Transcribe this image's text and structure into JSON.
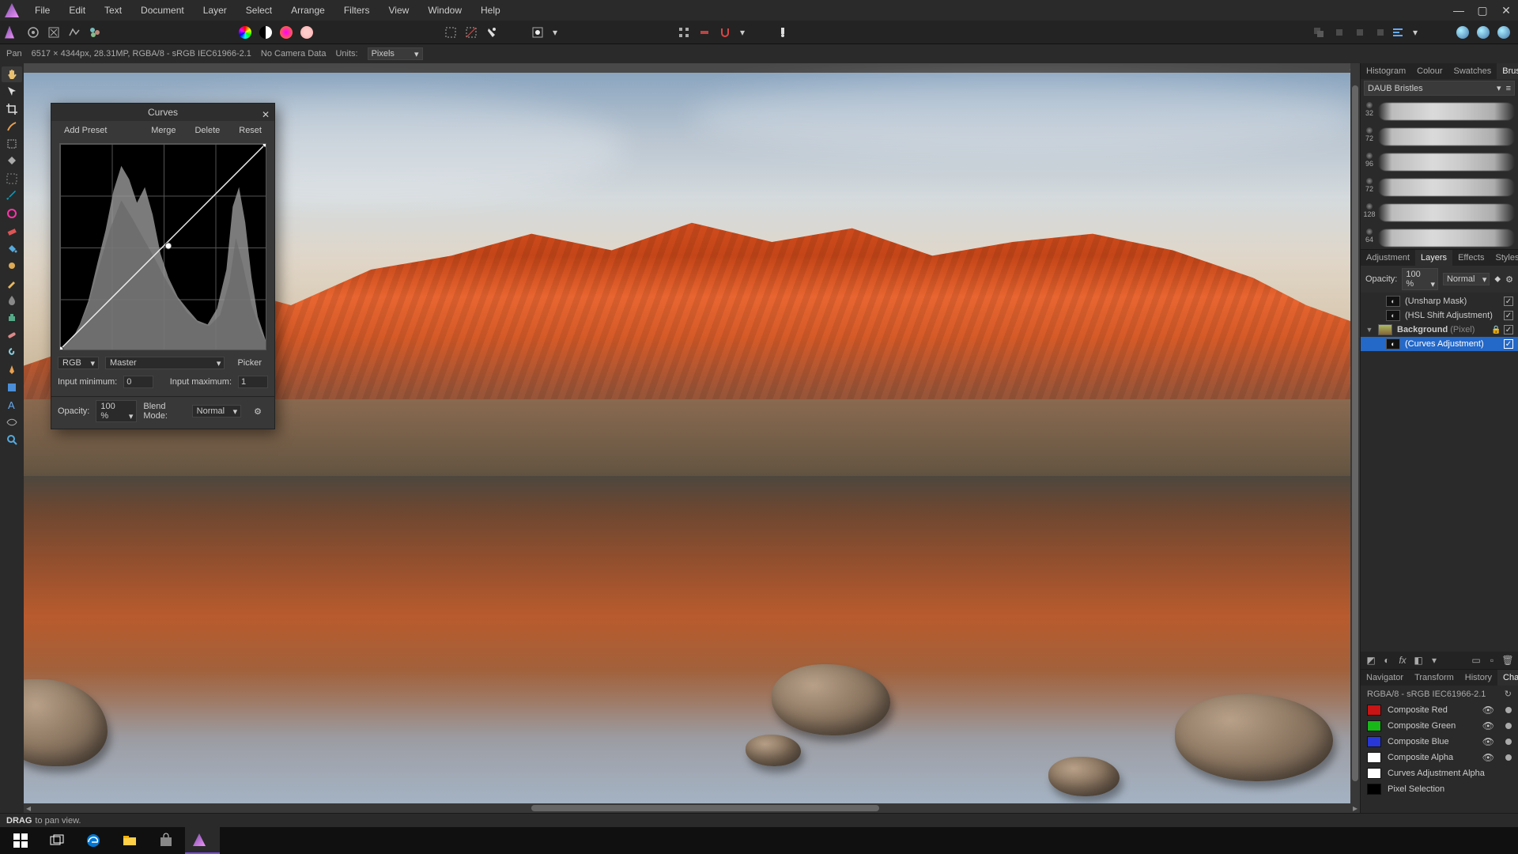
{
  "menu": [
    "File",
    "Edit",
    "Text",
    "Document",
    "Layer",
    "Select",
    "Arrange",
    "Filters",
    "View",
    "Window",
    "Help"
  ],
  "context": {
    "tool_label": "Pan",
    "doc_info": "6517 × 4344px, 28.31MP, RGBA/8 - sRGB IEC61966-2.1",
    "camera": "No Camera Data",
    "units_label": "Units:",
    "units_value": "Pixels"
  },
  "curves": {
    "title": "Curves",
    "add_preset": "Add Preset",
    "merge": "Merge",
    "delete": "Delete",
    "reset": "Reset",
    "channel_mode": "RGB",
    "channel": "Master",
    "picker": "Picker",
    "input_min_label": "Input minimum:",
    "input_min": "0",
    "input_max_label": "Input maximum:",
    "input_max": "1",
    "opacity_label": "Opacity:",
    "opacity": "100 %",
    "blendmode_label": "Blend Mode:",
    "blendmode": "Normal"
  },
  "right_tabs1": [
    "Histogram",
    "Colour",
    "Swatches",
    "Brushes"
  ],
  "brush_set": "DAUB Bristles",
  "brushes": [
    {
      "size": "32"
    },
    {
      "size": "72"
    },
    {
      "size": "96"
    },
    {
      "size": "72"
    },
    {
      "size": "128"
    },
    {
      "size": "64"
    }
  ],
  "right_tabs2": [
    "Adjustment",
    "Layers",
    "Effects",
    "Styles"
  ],
  "layers_ctrl": {
    "opacity_label": "Opacity:",
    "opacity": "100 %",
    "blendmode": "Normal"
  },
  "layers": [
    {
      "name": "(Unsharp Mask)",
      "checked": true
    },
    {
      "name": "(HSL Shift Adjustment)",
      "checked": true
    }
  ],
  "bg_layer": {
    "name": "Background",
    "type": "(Pixel)",
    "checked": true
  },
  "bg_child": {
    "name": "(Curves Adjustment)",
    "checked": true
  },
  "right_tabs3": [
    "Navigator",
    "Transform",
    "History",
    "Channels"
  ],
  "channel_header": "RGBA/8 - sRGB IEC61966-2.1",
  "channels": [
    {
      "name": "Composite Red",
      "color": "#c81414"
    },
    {
      "name": "Composite Green",
      "color": "#18b818"
    },
    {
      "name": "Composite Blue",
      "color": "#2838d8"
    },
    {
      "name": "Composite Alpha",
      "color": "#ffffff"
    },
    {
      "name": "Curves Adjustment Alpha",
      "color": "#ffffff"
    },
    {
      "name": "Pixel Selection",
      "color": "#000000"
    }
  ],
  "status": {
    "strong": "DRAG",
    "text": "to pan view."
  }
}
